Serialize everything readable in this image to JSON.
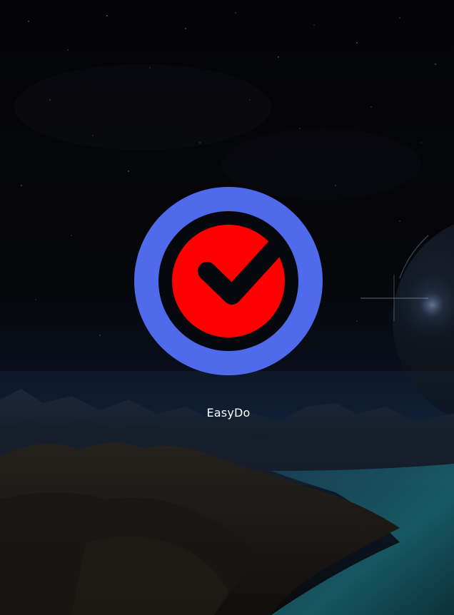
{
  "app": {
    "name": "EasyDo"
  },
  "colors": {
    "logo_ring": "#4f6aeb",
    "logo_inner": "#ff0000",
    "logo_gap": "#07080d",
    "text": "#ffffff"
  },
  "icons": {
    "logo": "check-circle-icon",
    "background": "alien-landscape-night-sky"
  }
}
